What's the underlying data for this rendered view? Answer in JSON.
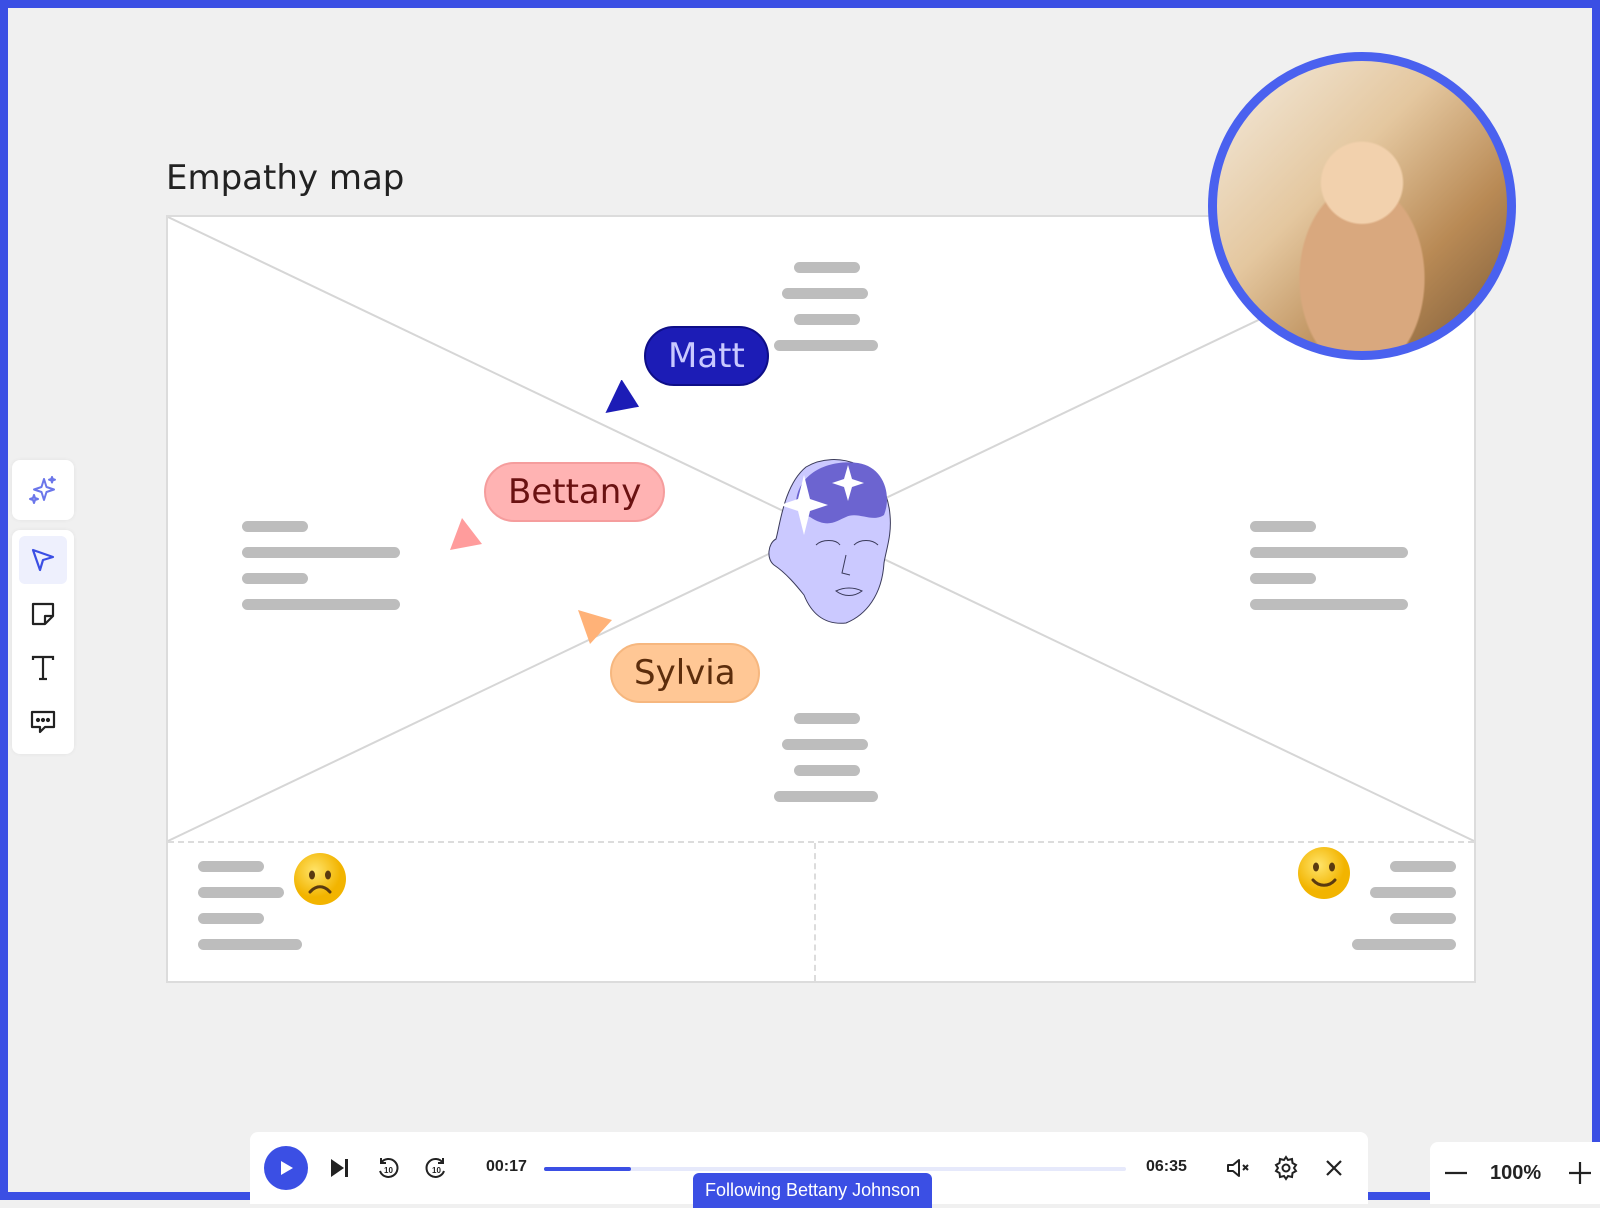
{
  "board": {
    "title": "Empathy map"
  },
  "collaborators": [
    {
      "name": "Matt",
      "color": "#1c1cb6"
    },
    {
      "name": "Bettany",
      "color": "#ffb3b3"
    },
    {
      "name": "Sylvia",
      "color": "#ffc795"
    }
  ],
  "toolbar": {
    "ai_tool": "sparkle-icon",
    "tools": [
      "select-cursor-icon",
      "sticky-note-icon",
      "text-icon",
      "comment-icon"
    ],
    "active_tool": "select-cursor-icon"
  },
  "player": {
    "current_time": "00:17",
    "total_time": "06:35",
    "progress": 0.15,
    "following_label": "Following Bettany Johnson"
  },
  "zoom": {
    "level": "100%"
  },
  "colors": {
    "accent": "#3b4fe4",
    "frame": "#3b4fe4"
  }
}
